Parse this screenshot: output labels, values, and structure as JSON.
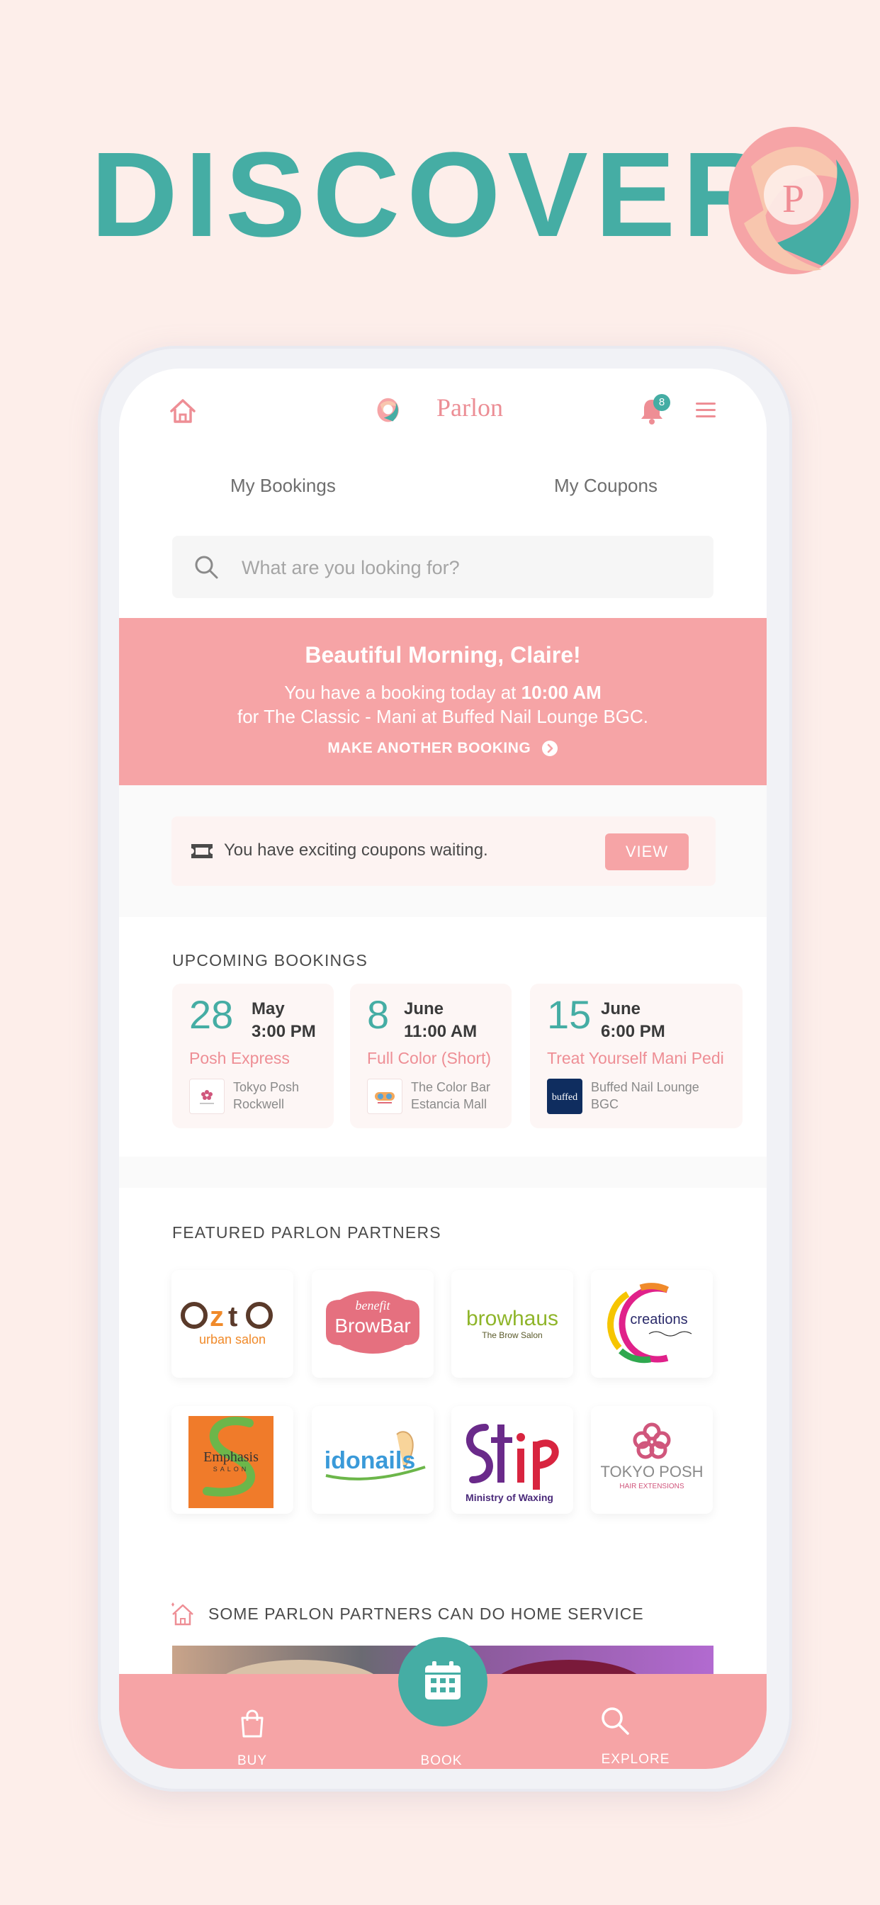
{
  "hero": {
    "title": "DISCOVER"
  },
  "header": {
    "brand_name": "Parlon",
    "notification_count": "8"
  },
  "tabs": [
    {
      "label": "My Bookings"
    },
    {
      "label": "My Coupons"
    }
  ],
  "search": {
    "placeholder": "What are you looking for?"
  },
  "greeting": {
    "title": "Beautiful Morning, Claire!",
    "line1_prefix": "You have a booking today at ",
    "line1_time": "10:00 AM",
    "line2": "for The Classic - Mani at Buffed Nail Lounge BGC.",
    "cta": "MAKE ANOTHER BOOKING"
  },
  "coupons": {
    "message": "You have exciting coupons waiting.",
    "button": "VIEW"
  },
  "upcoming": {
    "title": "UPCOMING BOOKINGS",
    "bookings": [
      {
        "day": "28",
        "month": "May",
        "time": "3:00 PM",
        "service": "Posh Express",
        "salon_line1": "Tokyo Posh",
        "salon_line2": "Rockwell"
      },
      {
        "day": "8",
        "month": "June",
        "time": "11:00 AM",
        "service": "Full Color (Short)",
        "salon_line1": "The Color Bar",
        "salon_line2": "Estancia Mall"
      },
      {
        "day": "15",
        "month": "June",
        "time": "6:00 PM",
        "service": "Treat Yourself Mani Pedi",
        "salon_line1": "Buffed Nail Lounge",
        "salon_line2": "BGC"
      }
    ]
  },
  "featured": {
    "title": "FEATURED PARLON PARTNERS",
    "partners": [
      {
        "name": "azta",
        "tagline": "urban salon"
      },
      {
        "name": "BrowBar",
        "tagline": "benefit"
      },
      {
        "name": "browhaus",
        "tagline": "The Brow Salon"
      },
      {
        "name": "creations",
        "tagline": ""
      },
      {
        "name": "Emphasis",
        "tagline": "SALON"
      },
      {
        "name": "idonails",
        "tagline": ""
      },
      {
        "name": "Strip",
        "tagline": "Ministry of Waxing"
      },
      {
        "name": "TOKYO POSH",
        "tagline": "HAIR EXTENSIONS"
      }
    ]
  },
  "home_service": {
    "title": "SOME PARLON PARTNERS CAN DO HOME SERVICE"
  },
  "tabbar": {
    "buy": "BUY",
    "book": "BOOK",
    "explore": "EXPLORE"
  },
  "colors": {
    "background": "#fdeeea",
    "teal": "#45ada4",
    "pink": "#f6a4a6",
    "pink_text": "#ee8e95"
  }
}
